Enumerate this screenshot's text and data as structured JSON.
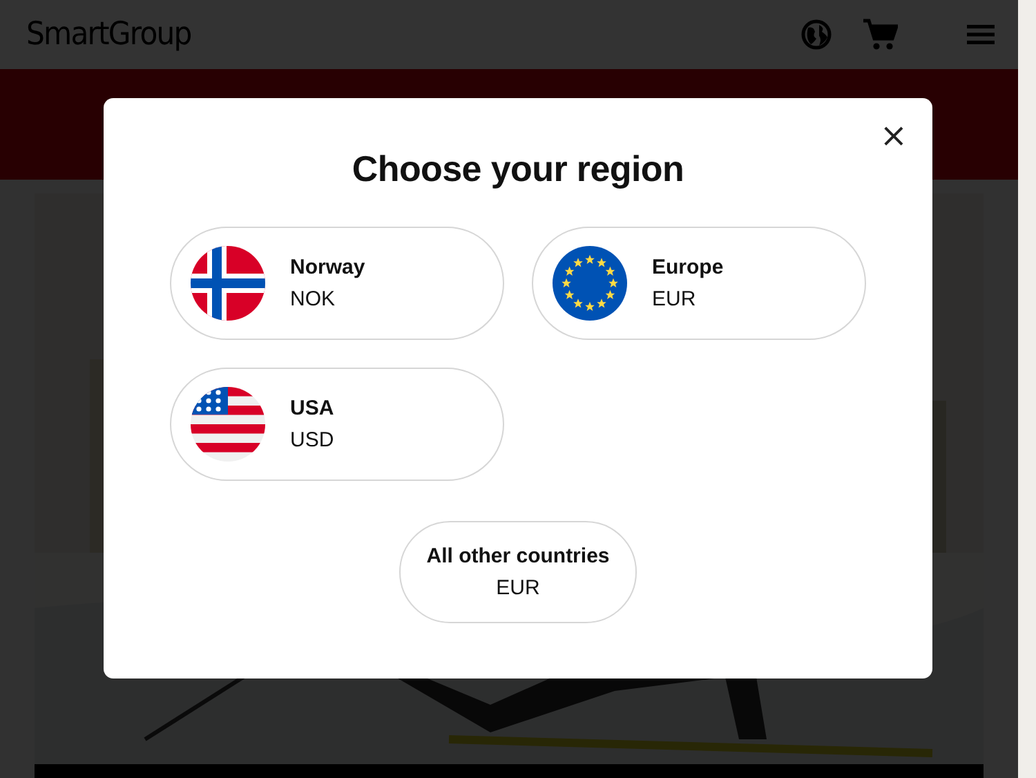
{
  "header": {
    "logo": "SmartGroup"
  },
  "modal": {
    "title": "Choose your region",
    "close": "×",
    "regions": [
      {
        "name": "Norway",
        "currency": "NOK",
        "kind": "norway"
      },
      {
        "name": "Europe",
        "currency": "EUR",
        "kind": "europe"
      },
      {
        "name": "USA",
        "currency": "USD",
        "kind": "usa"
      }
    ],
    "other": {
      "name": "All other countries",
      "currency": "EUR"
    }
  }
}
